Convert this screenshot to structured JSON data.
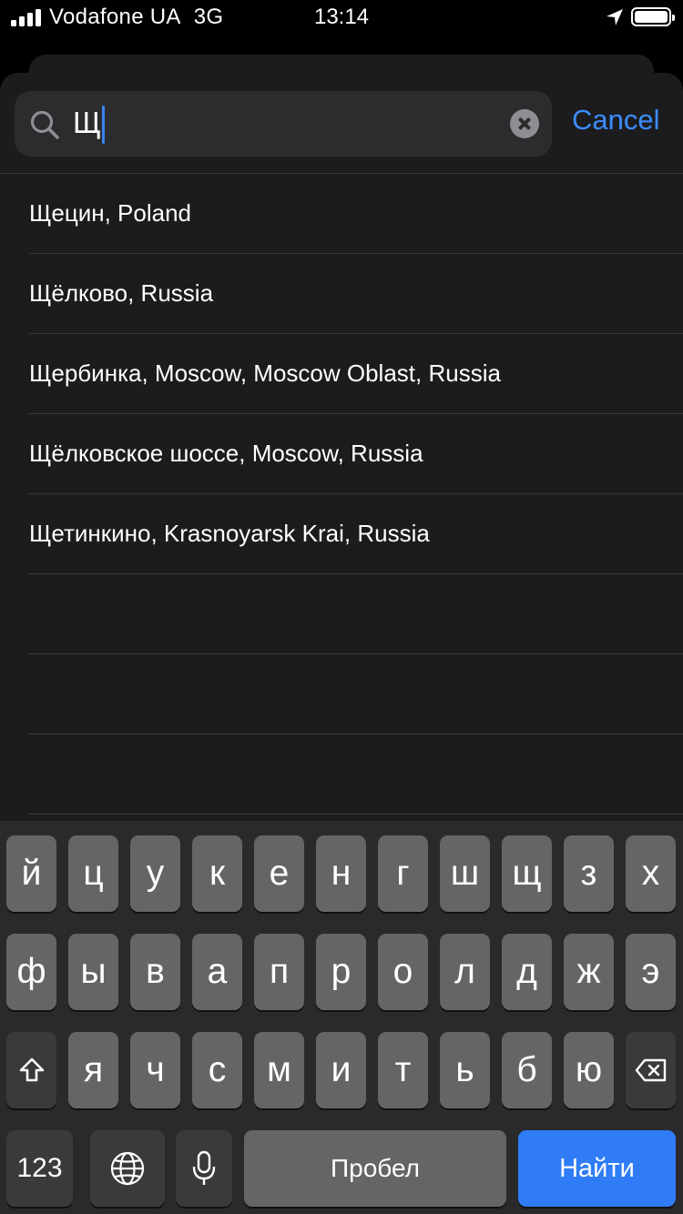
{
  "status_bar": {
    "carrier": "Vodafone UA",
    "network": "3G",
    "time": "13:14",
    "icons": [
      "signal-icon",
      "location-arrow-icon",
      "battery-icon"
    ]
  },
  "search": {
    "query": "Щ",
    "cancel_label": "Cancel"
  },
  "results": [
    "Щецин, Poland",
    "Щёлково, Russia",
    "Щербинка, Moscow, Moscow Oblast, Russia",
    "Щёлковское шоссе, Moscow, Russia",
    "Щетинкино, Krasnoyarsk Krai, Russia",
    "",
    "",
    ""
  ],
  "keyboard": {
    "row1": [
      "й",
      "ц",
      "у",
      "к",
      "е",
      "н",
      "г",
      "ш",
      "щ",
      "з",
      "х"
    ],
    "row2": [
      "ф",
      "ы",
      "в",
      "а",
      "п",
      "р",
      "о",
      "л",
      "д",
      "ж",
      "э"
    ],
    "row3": [
      "я",
      "ч",
      "с",
      "м",
      "и",
      "т",
      "ь",
      "б",
      "ю"
    ],
    "numbers_label": "123",
    "space_label": "Пробел",
    "return_label": "Найти"
  },
  "colors": {
    "accent": "#3b8cff",
    "return_key": "#2f7cf6",
    "sheet_background": "#1c1c1e"
  }
}
